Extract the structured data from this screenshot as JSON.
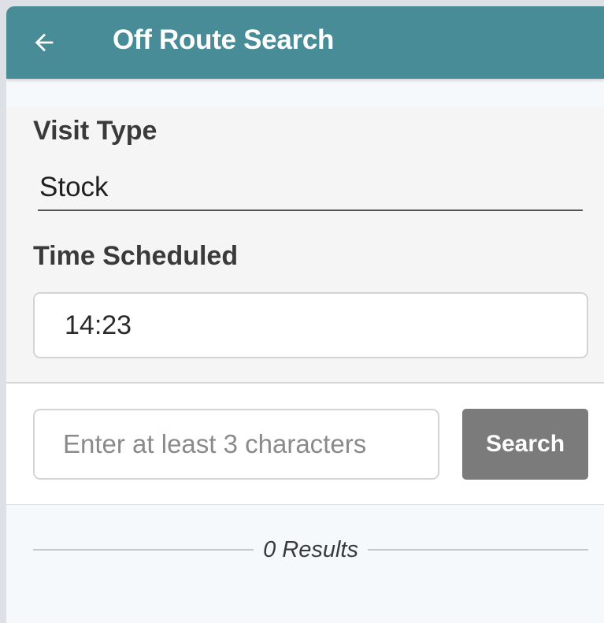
{
  "header": {
    "title": "Off Route Search",
    "back_icon": "arrow-left-icon",
    "background": "#478c96"
  },
  "visit_type": {
    "label": "Visit Type",
    "value": "Stock"
  },
  "time_scheduled": {
    "label": "Time Scheduled",
    "value": "14:23"
  },
  "search": {
    "placeholder": "Enter at least 3 characters",
    "button_label": "Search"
  },
  "results": {
    "label": "0 Results"
  }
}
